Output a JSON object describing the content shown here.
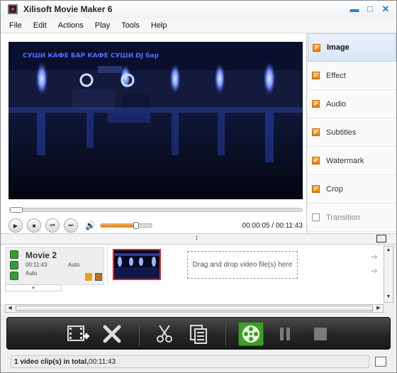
{
  "window": {
    "title": "Xilisoft Movie Maker 6"
  },
  "menu": [
    "File",
    "Edit",
    "Actions",
    "Play",
    "Tools",
    "Help"
  ],
  "player": {
    "current_time": "00:00:05",
    "total_time": "00:11:43",
    "time_separator": " / ",
    "volume": 0.7
  },
  "tabs": [
    {
      "label": "Image",
      "checked": true,
      "active": true
    },
    {
      "label": "Effect",
      "checked": true
    },
    {
      "label": "Audio",
      "checked": true
    },
    {
      "label": "Subtitles",
      "checked": true
    },
    {
      "label": "Watermark",
      "checked": true
    },
    {
      "label": "Crop",
      "checked": true
    },
    {
      "label": "Transition",
      "checked": false,
      "disabled": true
    }
  ],
  "movie": {
    "name": "Movie 2",
    "duration": "00:11:43",
    "auto_label_1": "Auto",
    "auto_label_2": "Auto",
    "add_label": "+"
  },
  "timeline": {
    "drop_hint": "Drag and drop video file(s) here"
  },
  "status": {
    "text": "1 video clip(s) in total,",
    "time": " 00:11:43"
  },
  "toolbar_icons": [
    "add-video-icon",
    "delete-icon",
    "split-icon",
    "clip-list-icon",
    "convert-icon",
    "pause-icon",
    "stop-icon"
  ]
}
